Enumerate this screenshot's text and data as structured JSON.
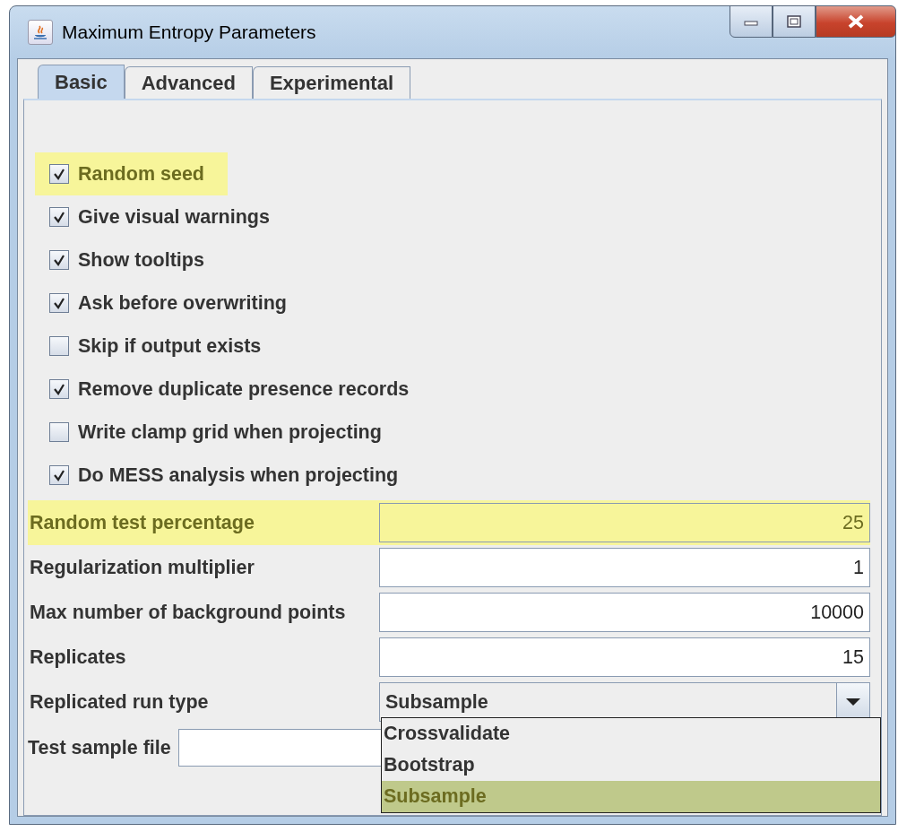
{
  "window": {
    "title": "Maximum Entropy Parameters"
  },
  "tabs": [
    {
      "label": "Basic",
      "selected": true
    },
    {
      "label": "Advanced",
      "selected": false
    },
    {
      "label": "Experimental",
      "selected": false
    }
  ],
  "checkboxes": [
    {
      "label": "Random seed",
      "checked": true,
      "highlighted": true
    },
    {
      "label": "Give visual warnings",
      "checked": true,
      "highlighted": false
    },
    {
      "label": "Show tooltips",
      "checked": true,
      "highlighted": false
    },
    {
      "label": "Ask before overwriting",
      "checked": true,
      "highlighted": false
    },
    {
      "label": "Skip if output exists",
      "checked": false,
      "highlighted": false
    },
    {
      "label": "Remove duplicate presence records",
      "checked": true,
      "highlighted": false
    },
    {
      "label": "Write clamp grid when projecting",
      "checked": false,
      "highlighted": false
    },
    {
      "label": "Do MESS analysis when projecting",
      "checked": true,
      "highlighted": false
    }
  ],
  "fields": [
    {
      "label": "Random test percentage",
      "value": "25",
      "highlighted": true
    },
    {
      "label": "Regularization multiplier",
      "value": "1",
      "highlighted": false
    },
    {
      "label": "Max number of background points",
      "value": "10000",
      "highlighted": false
    },
    {
      "label": "Replicates",
      "value": "15",
      "highlighted": false
    }
  ],
  "run_type": {
    "label": "Replicated run type",
    "value": "Subsample",
    "expanded": true,
    "options": [
      {
        "label": "Crossvalidate",
        "selected": false,
        "highlighted": false
      },
      {
        "label": "Bootstrap",
        "selected": false,
        "highlighted": false
      },
      {
        "label": "Subsample",
        "selected": true,
        "highlighted": true
      }
    ]
  },
  "test_sample_file": {
    "label": "Test sample file"
  }
}
